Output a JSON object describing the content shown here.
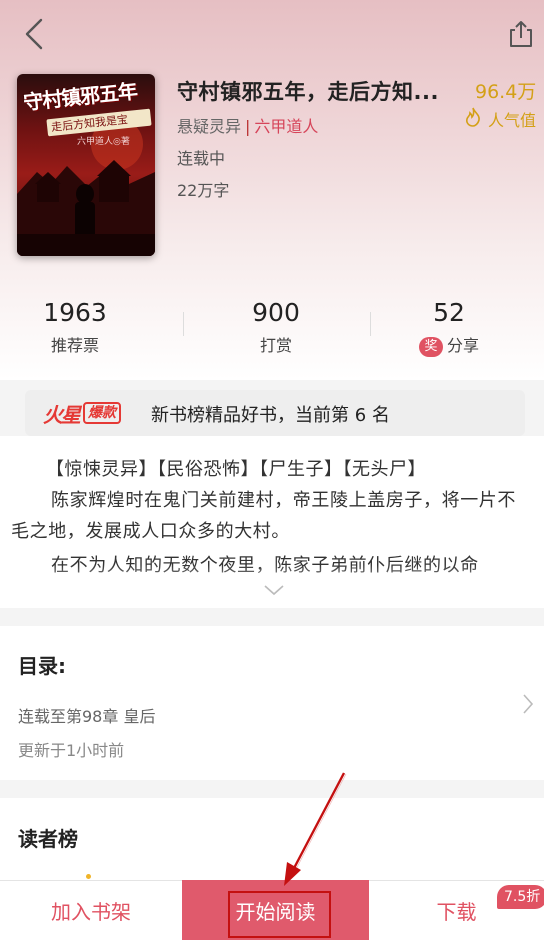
{
  "book": {
    "title": "守村镇邪五年，走后方知...",
    "genre": "悬疑灵异",
    "separator": "|",
    "author": "六甲道人",
    "status": "连载中",
    "word_count": "22万字",
    "popularity_value": "96.4万",
    "popularity_label": "人气值"
  },
  "cover": {
    "title": "守村镇邪五年",
    "subtitle": "走后方知我是宝",
    "author": "六甲道人◎著"
  },
  "stats": [
    {
      "value": "1963",
      "label": "推荐票"
    },
    {
      "value": "900",
      "label": "打赏"
    },
    {
      "value": "52",
      "label": "分享",
      "badge": "奖"
    }
  ],
  "rank": {
    "logo_fire": "火星",
    "logo_badge": "爆款",
    "text": "新书榜精品好书，当前第 6 名"
  },
  "description": {
    "tags": "【惊悚灵异】【民俗恐怖】【尸生子】【无头尸】",
    "paragraph1": "陈家辉煌时在鬼门关前建村，帝王陵上盖房子，将一片不毛之地，发展成人口众多的大村。",
    "paragraph2": "在不为人知的无数个夜里，陈家子弟前仆后继的以命"
  },
  "toc": {
    "title": "目录:",
    "latest": "连载至第98章 皇后",
    "updated": "更新于1小时前"
  },
  "readers": {
    "title": "读者榜"
  },
  "bottom_bar": {
    "add_shelf": "加入书架",
    "start_reading": "开始阅读",
    "download": "下载",
    "discount": "7.5折"
  },
  "icons": {
    "back": "back-icon",
    "share": "share-icon",
    "flame": "flame-icon",
    "expand": "chevron-down-icon",
    "toc_arrow": "chevron-right-icon"
  },
  "colors": {
    "accent": "#e05a6c",
    "author": "#d6455a",
    "popularity": "#d4a017",
    "annotation": "#c41010"
  }
}
